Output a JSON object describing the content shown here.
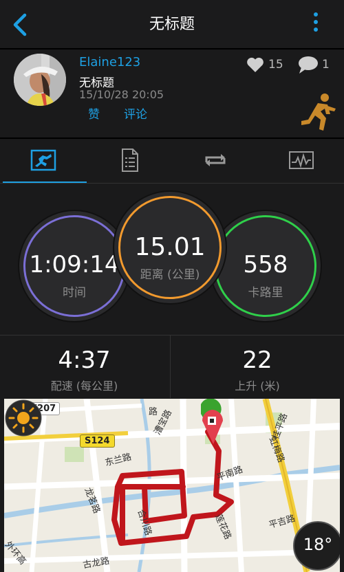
{
  "header": {
    "title": "无标题"
  },
  "activity": {
    "username": "Elaine123",
    "title": "无标题",
    "datetime": "15/10/28 20:05",
    "like_label": "赞",
    "comment_label": "评论",
    "likes": "15",
    "comments": "1"
  },
  "tabs": [
    {
      "name": "overview",
      "active": true
    },
    {
      "name": "details"
    },
    {
      "name": "laps"
    },
    {
      "name": "charts"
    }
  ],
  "metrics": {
    "time": {
      "value": "1:09:14",
      "label": "时间",
      "color": "#7b6fd6"
    },
    "distance": {
      "value": "15.01",
      "label": "距离 (公里)",
      "color": "#f29a2e"
    },
    "calories": {
      "value": "558",
      "label": "卡路里",
      "color": "#2fd04a"
    }
  },
  "stats": {
    "pace": {
      "value": "4:37",
      "label": "配速 (每公里)"
    },
    "ascent": {
      "value": "22",
      "label": "上升 (米)"
    }
  },
  "map": {
    "roads": {
      "x207": "X207",
      "s124": "S124",
      "caobao": "漕宝路",
      "guiping": "桂平路",
      "hongmei": "虹梅路",
      "donglan": "东兰路",
      "pingnan": "平南路",
      "longming": "龙茗路",
      "hechuan": "合川路",
      "lianhua": "莲花路",
      "pingji": "平吉路",
      "gulong": "古龙路",
      "outer_ring": "外环高",
      "partial_left": "路",
      "partial_top": "路",
      "caopartial": "漕"
    },
    "temperature": "18°",
    "route_color": "#c0161c"
  },
  "colors": {
    "accent": "#1ea0e3"
  }
}
